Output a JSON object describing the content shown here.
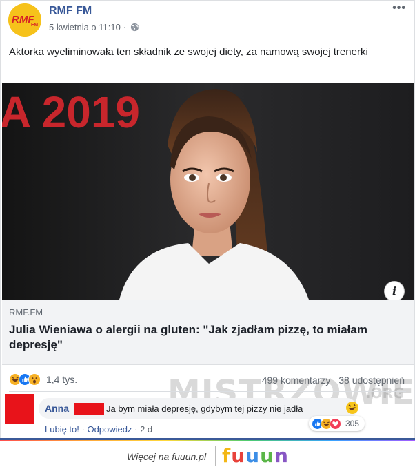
{
  "post": {
    "page_name": "RMF FM",
    "avatar_text": "RMF FM",
    "timestamp": "5 kwietnia o 11:10 ·",
    "more_label": "•••",
    "text": "Aktorka wyeliminowała ten składnik ze swojej diety, za namową swojej trenerki"
  },
  "image": {
    "backdrop_text": "A 2019",
    "info_label": "i"
  },
  "link_card": {
    "domain": "RMF.FM",
    "title": "Julia Wieniawa o alergii na gluten: \"Jak zjadłam pizzę, to miałam depresję\""
  },
  "reactions": {
    "icons": [
      "haha-icon",
      "like-icon",
      "wow-icon"
    ],
    "count": "1,4 tys.",
    "comments": "499 komentarzy",
    "shares": "38 udostępnień"
  },
  "comment": {
    "author": "Anna",
    "text": "Ja bym miała depresję, gdybym tej pizzy nie jadła",
    "reaction_icons": [
      "like-icon",
      "haha-icon",
      "love-icon"
    ],
    "reaction_count": "305",
    "like_label": "Lubię to!",
    "reply_label": "Odpowiedz",
    "age": "2 d"
  },
  "watermark": {
    "text": "MISTRZOWIE",
    "suffix": ".ORG"
  },
  "footer": {
    "text": "Więcej na fuuun.pl",
    "brand_letters": [
      "f",
      "u",
      "u",
      "u",
      "n"
    ]
  },
  "colors": {
    "link_blue": "#385898",
    "avatar_yellow": "#f6c21b",
    "redaction_red": "#e8131a",
    "like_blue": "#1877f2",
    "love_red": "#f33e58",
    "haha_yellow": "#f7b125"
  }
}
